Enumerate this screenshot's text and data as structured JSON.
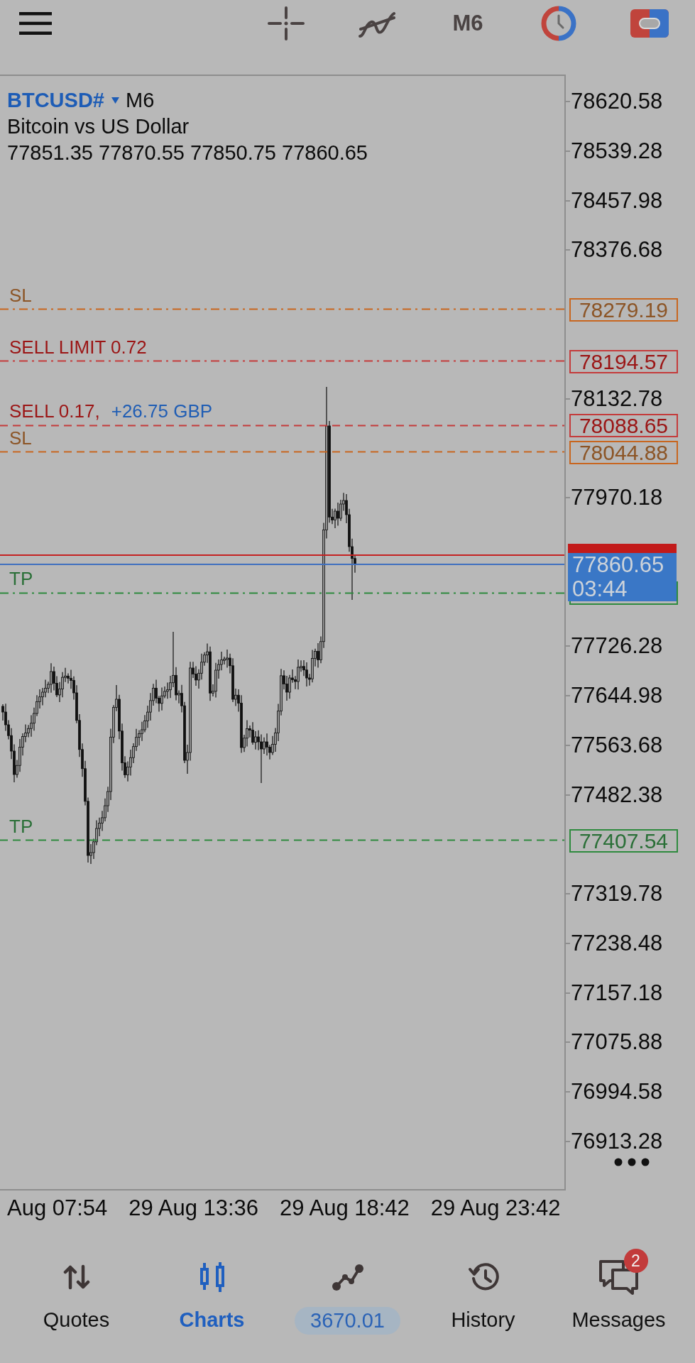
{
  "toolbar": {
    "timeframe": "M6"
  },
  "chart": {
    "symbol": "BTCUSD#",
    "timeframe": "M6",
    "description": "Bitcoin vs US Dollar",
    "ohlc": "77851.35 77870.55 77850.75 77860.65",
    "price_axis": [
      "78620.58",
      "78539.28",
      "78457.98",
      "78376.68",
      "78132.78",
      "77970.18",
      "77726.28",
      "77644.98",
      "77563.68",
      "77482.38",
      "77319.78",
      "77238.48",
      "77157.18",
      "77075.88",
      "76994.58",
      "76913.28"
    ],
    "order_lines": [
      {
        "kind": "stop_loss",
        "pending": true,
        "label": "SL",
        "price": "78279.19"
      },
      {
        "kind": "sell_limit",
        "pending": true,
        "label": "SELL LIMIT 0.72",
        "price": "78194.57"
      },
      {
        "kind": "sell",
        "pending": false,
        "label": "SELL 0.17,",
        "profit": "+26.75 GBP",
        "price": "78088.65"
      },
      {
        "kind": "stop_loss",
        "pending": false,
        "label": "SL",
        "price": "78044.88"
      },
      {
        "kind": "take_profit",
        "pending": true,
        "label": "TP"
      },
      {
        "kind": "take_profit",
        "pending": false,
        "label": "TP",
        "price": "77407.54"
      }
    ],
    "quote": {
      "bid": "77860.65",
      "countdown": "03:44"
    },
    "time_axis": [
      "Aug 07:54",
      "29 Aug 13:36",
      "29 Aug 18:42",
      "29 Aug 23:42"
    ]
  },
  "nav": [
    {
      "kind": "quotes",
      "label": "Quotes",
      "selected": false
    },
    {
      "kind": "charts",
      "label": "Charts",
      "selected": true
    },
    {
      "kind": "trade",
      "value": "3670.01",
      "selected": false
    },
    {
      "kind": "history",
      "label": "History",
      "selected": false
    },
    {
      "kind": "messages",
      "label": "Messages",
      "badge": "2",
      "selected": false
    }
  ]
}
